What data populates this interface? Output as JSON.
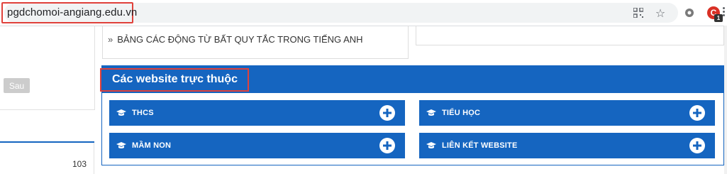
{
  "browser": {
    "url": "pgdchomoi-angiang.edu.vn",
    "icons": [
      "qr-code-icon",
      "bookmark-star-icon",
      "extension-gear-icon",
      "extension-c-icon",
      "menu-dots-icon"
    ],
    "extension_badge": "1"
  },
  "left_panel": {
    "next_button_label": "Sau",
    "counter": "103"
  },
  "article": {
    "chevron": "»",
    "title": "BẢNG CÁC ĐỘNG TỪ BẤT QUY TẮC TRONG TIẾNG ANH"
  },
  "affiliated_section": {
    "title": "Các website trực thuộc",
    "links": [
      {
        "label": "THCS",
        "icon": "graduation-cap-icon"
      },
      {
        "label": "TIỂU HỌC",
        "icon": "graduation-cap-icon"
      },
      {
        "label": "MẦM NON",
        "icon": "graduation-cap-icon"
      },
      {
        "label": "LIÊN KẾT WEBSITE",
        "icon": "graduation-cap-icon"
      }
    ],
    "colors": {
      "primary": "#1565c0",
      "highlight": "#e0413b"
    }
  }
}
